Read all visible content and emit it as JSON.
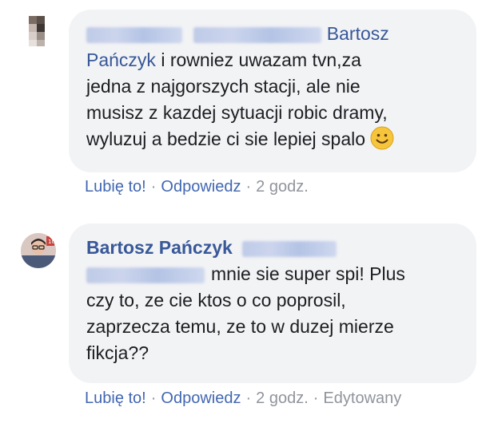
{
  "comments": [
    {
      "author_prefix_name": "Bartosz",
      "author_prefix_name2": "Pańczyk",
      "lines": [
        " i rowniez uwazam tvn,za",
        "jedna z najgorszych stacji, ale nie",
        "musisz z kazdej sytuacji robic dramy,",
        "wyluzuj a bedzie ci sie lepiej spalo"
      ],
      "emoji": "smiley-face-icon",
      "actions": {
        "like": "Lubię to!",
        "reply": "Odpowiedz",
        "time": "2 godz."
      }
    },
    {
      "author": "Bartosz Pańczyk",
      "lines": [
        "mnie sie super spi! Plus",
        "czy to, ze cie ktos o co poprosil,",
        "zaprzecza temu, ze to w duzej mierze",
        "fikcja??"
      ],
      "actions": {
        "like": "Lubię to!",
        "reply": "Odpowiedz",
        "time": "2 godz.",
        "edited": "Edytowany"
      }
    }
  ],
  "colors": {
    "link": "#385898",
    "action_link": "#4267b2",
    "meta": "#90949c",
    "bubble": "#f2f3f5",
    "text": "#1c1e21",
    "emoji": "#f7c53b"
  }
}
